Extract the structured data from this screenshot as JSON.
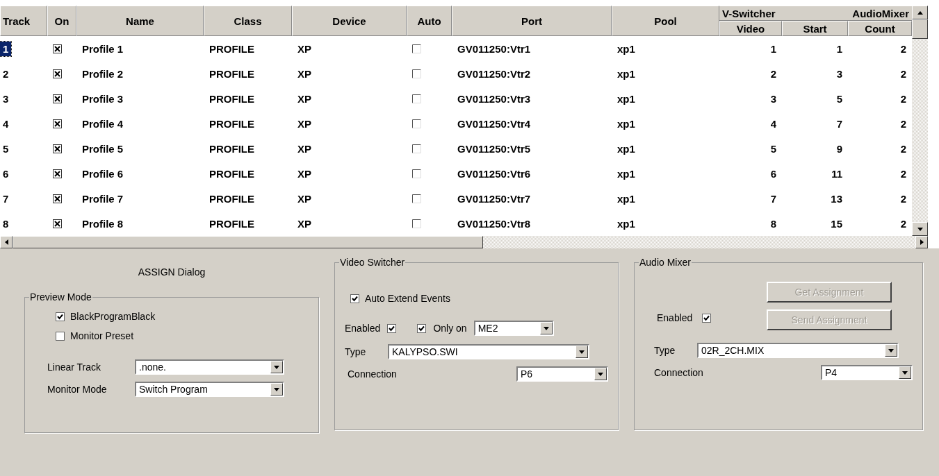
{
  "table": {
    "columns": [
      "Track",
      "On",
      "Name",
      "Class",
      "Device",
      "Auto",
      "Port",
      "Pool"
    ],
    "group_headers": [
      "V-Switcher",
      "AudioMixer"
    ],
    "sub_columns": [
      "Video",
      "Start",
      "Count"
    ],
    "rows": [
      {
        "selected": true,
        "track": "1",
        "on": true,
        "name": "Profile 1",
        "class": "PROFILE",
        "device": "XP",
        "auto": false,
        "port": "GV011250:Vtr1",
        "pool": "xp1",
        "video": "1",
        "start": "1",
        "count": "2"
      },
      {
        "selected": false,
        "track": "2",
        "on": true,
        "name": "Profile 2",
        "class": "PROFILE",
        "device": "XP",
        "auto": false,
        "port": "GV011250:Vtr2",
        "pool": "xp1",
        "video": "2",
        "start": "3",
        "count": "2"
      },
      {
        "selected": false,
        "track": "3",
        "on": true,
        "name": "Profile 3",
        "class": "PROFILE",
        "device": "XP",
        "auto": false,
        "port": "GV011250:Vtr3",
        "pool": "xp1",
        "video": "3",
        "start": "5",
        "count": "2"
      },
      {
        "selected": false,
        "track": "4",
        "on": true,
        "name": "Profile 4",
        "class": "PROFILE",
        "device": "XP",
        "auto": false,
        "port": "GV011250:Vtr4",
        "pool": "xp1",
        "video": "4",
        "start": "7",
        "count": "2"
      },
      {
        "selected": false,
        "track": "5",
        "on": true,
        "name": "Profile 5",
        "class": "PROFILE",
        "device": "XP",
        "auto": false,
        "port": "GV011250:Vtr5",
        "pool": "xp1",
        "video": "5",
        "start": "9",
        "count": "2"
      },
      {
        "selected": false,
        "track": "6",
        "on": true,
        "name": "Profile 6",
        "class": "PROFILE",
        "device": "XP",
        "auto": false,
        "port": "GV011250:Vtr6",
        "pool": "xp1",
        "video": "6",
        "start": "11",
        "count": "2"
      },
      {
        "selected": false,
        "track": "7",
        "on": true,
        "name": "Profile 7",
        "class": "PROFILE",
        "device": "XP",
        "auto": false,
        "port": "GV011250:Vtr7",
        "pool": "xp1",
        "video": "7",
        "start": "13",
        "count": "2"
      },
      {
        "selected": false,
        "track": "8",
        "on": true,
        "name": "Profile 8",
        "class": "PROFILE",
        "device": "XP",
        "auto": false,
        "port": "GV011250:Vtr8",
        "pool": "xp1",
        "video": "8",
        "start": "15",
        "count": "2"
      }
    ]
  },
  "assign_dialog": {
    "title": "ASSIGN Dialog",
    "preview_mode": {
      "title": "Preview Mode",
      "checkboxes": [
        {
          "label": "BlackProgramBlack",
          "checked": true
        },
        {
          "label": "Monitor Preset",
          "checked": false
        }
      ],
      "fields": [
        {
          "label": "Linear Track",
          "value": ".none."
        },
        {
          "label": "Monitor Mode",
          "value": "Switch Program"
        }
      ]
    }
  },
  "video_switcher": {
    "title": "Video Switcher",
    "auto_extend": {
      "label": "Auto Extend Events",
      "checked": true
    },
    "enabled": {
      "label": "Enabled",
      "checked": true
    },
    "only_on": {
      "label": "Only on",
      "checked": true,
      "value": "ME2"
    },
    "type": {
      "label": "Type",
      "value": "KALYPSO.SWI"
    },
    "connection": {
      "label": "Connection",
      "value": "P6"
    }
  },
  "audio_mixer": {
    "title": "Audio Mixer",
    "buttons": [
      {
        "label": "Get Assignment",
        "disabled": true
      },
      {
        "label": "Send Assignment",
        "disabled": true
      }
    ],
    "enabled": {
      "label": "Enabled",
      "checked": true
    },
    "type": {
      "label": "Type",
      "value": "02R_2CH.MIX"
    },
    "connection": {
      "label": "Connection",
      "value": "P4"
    }
  }
}
